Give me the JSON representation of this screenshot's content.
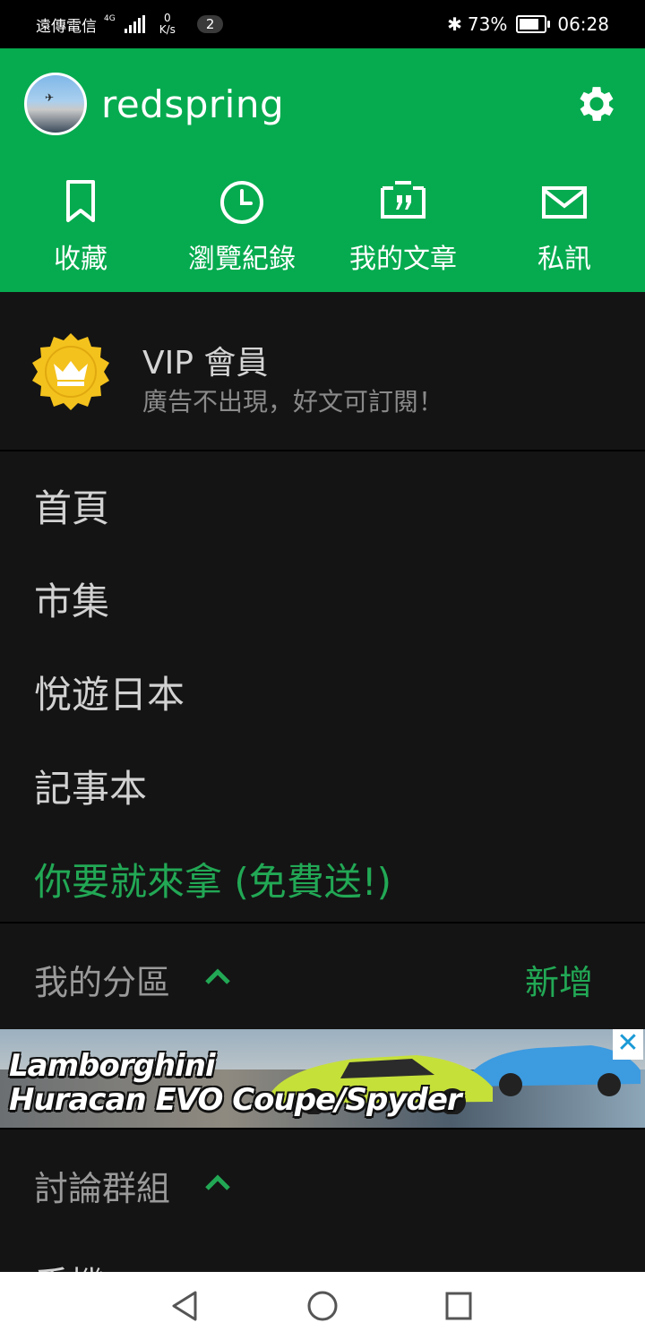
{
  "status_bar": {
    "carrier": "遠傳電信",
    "network": "4G",
    "speed_value": "0",
    "speed_unit": "K/s",
    "notification_count": "2",
    "battery": "73%",
    "time": "06:28"
  },
  "profile": {
    "username": "redspring"
  },
  "quick_actions": [
    {
      "label": "收藏",
      "icon": "bookmark-icon"
    },
    {
      "label": "瀏覽紀錄",
      "icon": "clock-icon"
    },
    {
      "label": "我的文章",
      "icon": "quote-icon"
    },
    {
      "label": "私訊",
      "icon": "mail-icon"
    }
  ],
  "vip": {
    "title": "VIP 會員",
    "subtitle": "廣告不出現，好文可訂閱！"
  },
  "menu": [
    {
      "label": "首頁"
    },
    {
      "label": "市集"
    },
    {
      "label": "悅遊日本"
    },
    {
      "label": "記事本"
    },
    {
      "label": "你要就來拿 (免費送!)"
    }
  ],
  "sections": {
    "my_boards": {
      "title": "我的分區",
      "action": "新增"
    },
    "groups": {
      "title": "討論群組"
    }
  },
  "ad": {
    "line1": "Lamborghini",
    "line2": "Huracan EVO Coupe/Spyder",
    "close": "✕"
  },
  "peek_item": "手機",
  "colors": {
    "accent": "#06ab4f",
    "accent_text": "#22a855",
    "background": "#141414"
  }
}
